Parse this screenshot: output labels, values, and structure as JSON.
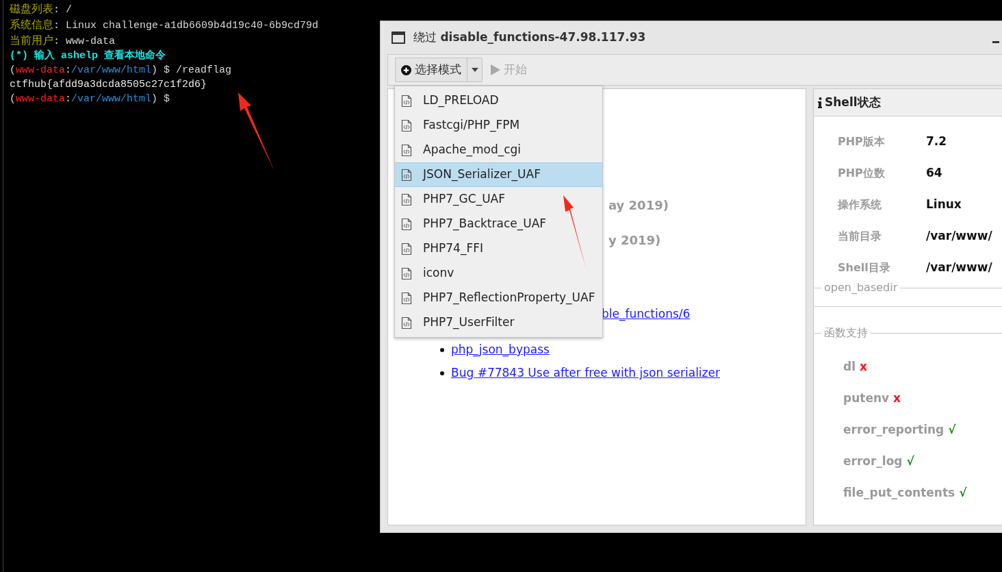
{
  "terminal": {
    "lines": [
      {
        "kind": "info",
        "label": "磁盘列表",
        "value": ": /"
      },
      {
        "kind": "info",
        "label": "系统信息",
        "value": ": Linux challenge-a1db6609b4d19c40-6b9cd79d"
      },
      {
        "kind": "info",
        "label": "当前用户",
        "value": ": www-data"
      },
      {
        "kind": "hint",
        "text": "(*) 输入 ashelp 查看本地命令"
      },
      {
        "kind": "prompt",
        "open": "(",
        "user": "www-data",
        "sep": ":",
        "path": "/var/www/html",
        "close": ") $",
        "command": "/readflag"
      },
      {
        "kind": "output",
        "text": "ctfhub{afdd9a3dcda8505c27c1f2d6}"
      },
      {
        "kind": "prompt",
        "open": "(",
        "user": "www-data",
        "sep": ":",
        "path": "/var/www/html",
        "close": ") $"
      }
    ]
  },
  "window": {
    "title": "绕过 **disable_functions-47.98.117.93**",
    "toolbar": {
      "mode_button": "选择模式",
      "start_button": {
        "label": "开始",
        "disabled": true
      }
    },
    "mode_menu": {
      "open": true,
      "items": [
        {
          "label": "LD_PRELOAD",
          "selected": false
        },
        {
          "label": "Fastcgi/PHP_FPM",
          "selected": false
        },
        {
          "label": "Apache_mod_cgi",
          "selected": false
        },
        {
          "label": "JSON_Serializer_UAF",
          "selected": true
        },
        {
          "label": "PHP7_GC_UAF",
          "selected": false
        },
        {
          "label": "PHP7_Backtrace_UAF",
          "selected": false
        },
        {
          "label": "PHP74_FFI",
          "selected": false
        },
        {
          "label": "iconv",
          "selected": false
        },
        {
          "label": "PHP7_ReflectionProperty_UAF",
          "selected": false
        },
        {
          "label": "PHP7_UserFilter",
          "selected": false
        }
      ]
    },
    "main": {
      "headings": [
        "ay 2019)",
        "y 2019)"
      ],
      "links": [
        {
          "text": "ble_functions/6",
          "bullet": false
        },
        {
          "text": "php_json_bypass",
          "bullet": true
        },
        {
          "text": "Bug #77843 Use after free with json serializer",
          "bullet": true
        }
      ]
    },
    "shell_status": {
      "title": "Shell状态",
      "rows": [
        {
          "label": "PHP版本",
          "value": "7.2"
        },
        {
          "label": "PHP位数",
          "value": "64"
        },
        {
          "label": "操作系统",
          "value": "Linux"
        },
        {
          "label": "当前目录",
          "value": "/var/www/"
        },
        {
          "label": "Shell目录",
          "value": "/var/www/"
        }
      ],
      "open_basedir": {
        "legend": "open_basedir"
      },
      "functions": {
        "legend": "函数支持",
        "items": [
          {
            "name": "dl",
            "supported": false,
            "mark": "x"
          },
          {
            "name": "putenv",
            "supported": false,
            "mark": "x"
          },
          {
            "name": "error_reporting",
            "supported": true,
            "mark": "√"
          },
          {
            "name": "error_log",
            "supported": true,
            "mark": "√"
          },
          {
            "name": "file_put_contents",
            "supported": true,
            "mark": "√"
          }
        ]
      }
    }
  }
}
